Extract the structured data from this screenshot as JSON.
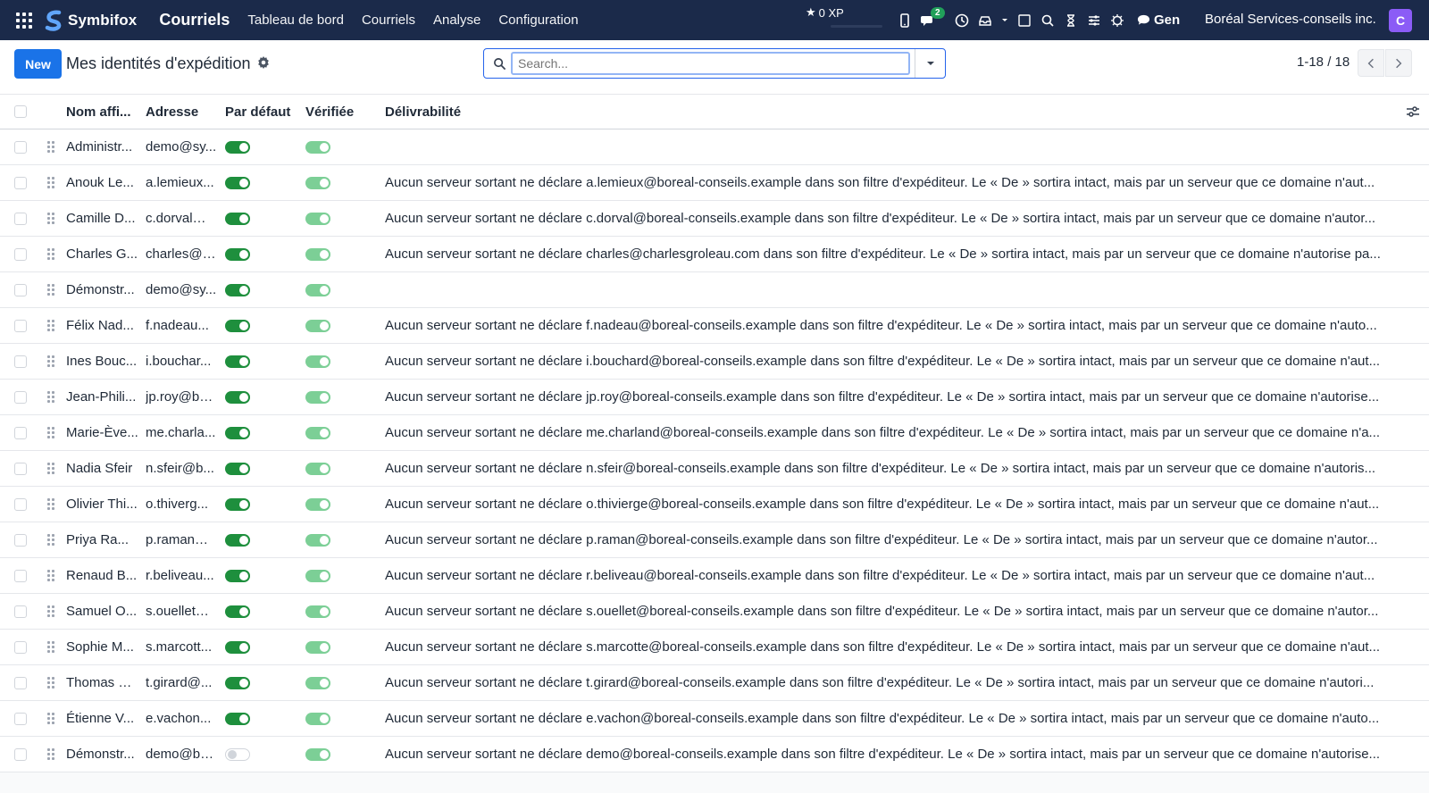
{
  "topbar": {
    "brand": "Symbifox",
    "app_name": "Courriels",
    "menu": [
      "Tableau de bord",
      "Courriels",
      "Analyse",
      "Configuration"
    ],
    "xp_label": "0 XP",
    "chat_badge": "2",
    "gen_label": "Gen",
    "company": "Boréal Services-conseils inc.",
    "avatar_initial": "C"
  },
  "control": {
    "new_label": "New",
    "title": "Mes identités d'expédition",
    "search_placeholder": "Search...",
    "pager": "1-18 / 18"
  },
  "columns": {
    "name": "Nom affi...",
    "address": "Adresse",
    "default": "Par défaut",
    "verified": "Vérifiée",
    "deliverability": "Délivrabilité"
  },
  "rows": [
    {
      "name": "Administr...",
      "address": "demo@sy...",
      "default": true,
      "verified": true,
      "deliverability": ""
    },
    {
      "name": "Anouk Le...",
      "address": "a.lemieux...",
      "default": true,
      "verified": true,
      "deliverability": "Aucun serveur sortant ne déclare a.lemieux@boreal-conseils.example dans son filtre d'expéditeur. Le « De » sortira intact, mais par un serveur que ce domaine n'aut..."
    },
    {
      "name": "Camille D...",
      "address": "c.dorval@...",
      "default": true,
      "verified": true,
      "deliverability": "Aucun serveur sortant ne déclare c.dorval@boreal-conseils.example dans son filtre d'expéditeur. Le « De » sortira intact, mais par un serveur que ce domaine n'autor..."
    },
    {
      "name": "Charles G...",
      "address": "charles@c...",
      "default": true,
      "verified": true,
      "deliverability": "Aucun serveur sortant ne déclare charles@charlesgroleau.com dans son filtre d'expéditeur. Le « De » sortira intact, mais par un serveur que ce domaine n'autorise pa..."
    },
    {
      "name": "Démonstr...",
      "address": "demo@sy...",
      "default": true,
      "verified": true,
      "deliverability": ""
    },
    {
      "name": "Félix Nad...",
      "address": "f.nadeau...",
      "default": true,
      "verified": true,
      "deliverability": "Aucun serveur sortant ne déclare f.nadeau@boreal-conseils.example dans son filtre d'expéditeur. Le « De » sortira intact, mais par un serveur que ce domaine n'auto..."
    },
    {
      "name": "Ines Bouc...",
      "address": "i.bouchar...",
      "default": true,
      "verified": true,
      "deliverability": "Aucun serveur sortant ne déclare i.bouchard@boreal-conseils.example dans son filtre d'expéditeur. Le « De » sortira intact, mais par un serveur que ce domaine n'aut..."
    },
    {
      "name": "Jean-Phili...",
      "address": "jp.roy@bo...",
      "default": true,
      "verified": true,
      "deliverability": "Aucun serveur sortant ne déclare jp.roy@boreal-conseils.example dans son filtre d'expéditeur. Le « De » sortira intact, mais par un serveur que ce domaine n'autorise..."
    },
    {
      "name": "Marie-Ève...",
      "address": "me.charla...",
      "default": true,
      "verified": true,
      "deliverability": "Aucun serveur sortant ne déclare me.charland@boreal-conseils.example dans son filtre d'expéditeur. Le « De » sortira intact, mais par un serveur que ce domaine n'a..."
    },
    {
      "name": "Nadia Sfeir",
      "address": "n.sfeir@b...",
      "default": true,
      "verified": true,
      "deliverability": "Aucun serveur sortant ne déclare n.sfeir@boreal-conseils.example dans son filtre d'expéditeur. Le « De » sortira intact, mais par un serveur que ce domaine n'autoris..."
    },
    {
      "name": "Olivier Thi...",
      "address": "o.thiverg...",
      "default": true,
      "verified": true,
      "deliverability": "Aucun serveur sortant ne déclare o.thivierge@boreal-conseils.example dans son filtre d'expéditeur. Le « De » sortira intact, mais par un serveur que ce domaine n'aut..."
    },
    {
      "name": "Priya Ra...",
      "address": "p.raman@...",
      "default": true,
      "verified": true,
      "deliverability": "Aucun serveur sortant ne déclare p.raman@boreal-conseils.example dans son filtre d'expéditeur. Le « De » sortira intact, mais par un serveur que ce domaine n'autor..."
    },
    {
      "name": "Renaud B...",
      "address": "r.beliveau...",
      "default": true,
      "verified": true,
      "deliverability": "Aucun serveur sortant ne déclare r.beliveau@boreal-conseils.example dans son filtre d'expéditeur. Le « De » sortira intact, mais par un serveur que ce domaine n'aut..."
    },
    {
      "name": "Samuel O...",
      "address": "s.ouellet@...",
      "default": true,
      "verified": true,
      "deliverability": "Aucun serveur sortant ne déclare s.ouellet@boreal-conseils.example dans son filtre d'expéditeur. Le « De » sortira intact, mais par un serveur que ce domaine n'autor..."
    },
    {
      "name": "Sophie M...",
      "address": "s.marcott...",
      "default": true,
      "verified": true,
      "deliverability": "Aucun serveur sortant ne déclare s.marcotte@boreal-conseils.example dans son filtre d'expéditeur. Le « De » sortira intact, mais par un serveur que ce domaine n'aut..."
    },
    {
      "name": "Thomas G...",
      "address": "t.girard@...",
      "default": true,
      "verified": true,
      "deliverability": "Aucun serveur sortant ne déclare t.girard@boreal-conseils.example dans son filtre d'expéditeur. Le « De » sortira intact, mais par un serveur que ce domaine n'autori..."
    },
    {
      "name": "Étienne V...",
      "address": "e.vachon...",
      "default": true,
      "verified": true,
      "deliverability": "Aucun serveur sortant ne déclare e.vachon@boreal-conseils.example dans son filtre d'expéditeur. Le « De » sortira intact, mais par un serveur que ce domaine n'auto..."
    },
    {
      "name": "Démonstr...",
      "address": "demo@bo...",
      "default": false,
      "verified": true,
      "deliverability": "Aucun serveur sortant ne déclare demo@boreal-conseils.example dans son filtre d'expéditeur. Le « De » sortira intact, mais par un serveur que ce domaine n'autorise..."
    }
  ],
  "colors": {
    "navbar": "#1b2a4a",
    "primary": "#1a73e8",
    "toggle_on": "#1e8f3d",
    "toggle_verified": "#7ccf96",
    "avatar": "#8b5cf6"
  }
}
